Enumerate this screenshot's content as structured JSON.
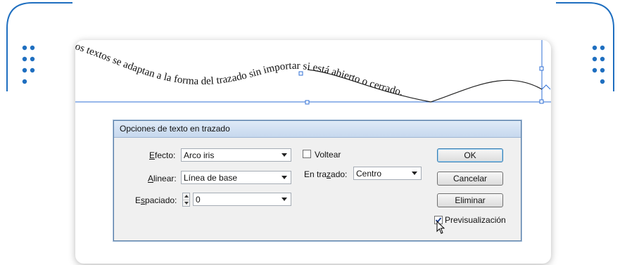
{
  "path_text": "Los textos se adaptan a la forma del trazado sin importar si está abierto o cerrado.",
  "dialog": {
    "title": "Opciones de texto en trazado",
    "efecto": {
      "label_prefix": "E",
      "label_rest": "fecto:",
      "value": "Arco iris"
    },
    "alinear": {
      "label_prefix": "A",
      "label_rest": "linear:",
      "value": "Línea de base"
    },
    "espaciado": {
      "label_pre": "E",
      "label_mid": "s",
      "label_rest": "paciado:",
      "value": "0"
    },
    "voltear": {
      "label": "Voltear",
      "checked": false
    },
    "en_trazado": {
      "label_pre": "En tra",
      "label_mid": "z",
      "label_rest": "ado:",
      "value": "Centro"
    },
    "buttons": {
      "ok": "OK",
      "cancel": "Cancelar",
      "delete": "Eliminar"
    },
    "preview": {
      "label": "Previsualización",
      "checked": true
    }
  },
  "colors": {
    "accent": "#1f6fc0",
    "guide": "#2f6fd6"
  }
}
